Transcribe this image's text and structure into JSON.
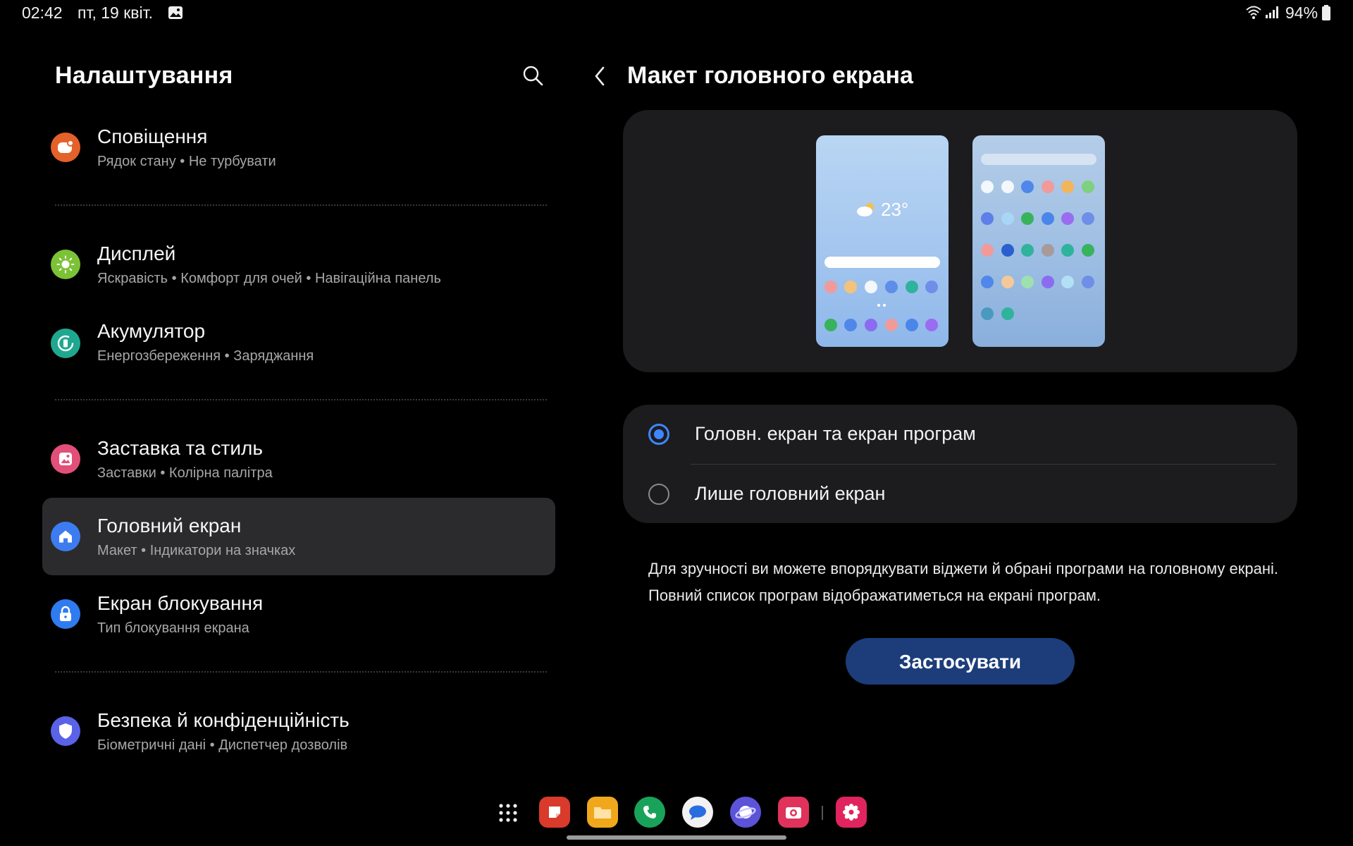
{
  "status_bar": {
    "time": "02:42",
    "date": "пт, 19 квіт.",
    "battery": "94%"
  },
  "left_pane": {
    "title": "Налаштування",
    "items": [
      {
        "title": "Сповіщення",
        "subtitle": "Рядок стану • Не турбувати",
        "icon": "notifications-icon",
        "color": "#e4612a"
      },
      {
        "title": "Дисплей",
        "subtitle": "Яскравість • Комфорт для очей • Навігаційна панель",
        "icon": "sun-icon",
        "color": "#7cc236"
      },
      {
        "title": "Акумулятор",
        "subtitle": "Енергозбереження • Заряджання",
        "icon": "battery-icon",
        "color": "#1fa88f"
      },
      {
        "title": "Заставка та стиль",
        "subtitle": "Заставки • Колірна палітра",
        "icon": "wallpaper-icon",
        "color": "#e2507a"
      },
      {
        "title": "Головний екран",
        "subtitle": "Макет • Індикатори на значках",
        "icon": "home-icon",
        "color": "#3c7cf0",
        "selected": true
      },
      {
        "title": "Екран блокування",
        "subtitle": "Тип блокування екрана",
        "icon": "lock-icon",
        "color": "#2f7bf0"
      },
      {
        "title": "Безпека й конфіденційність",
        "subtitle": "Біометричні дані • Диспетчер дозволів",
        "icon": "shield-icon",
        "color": "#5a62e8"
      }
    ]
  },
  "right_pane": {
    "title": "Макет головного екрана",
    "preview_temperature": "23°",
    "options": [
      {
        "label": "Головн. екран та екран програм",
        "selected": true
      },
      {
        "label": "Лише головний екран",
        "selected": false
      }
    ],
    "description": "Для зручності ви можете впорядкувати віджети й обрані програми на головному екрані. Повний список програм відображатиметься на екрані програм.",
    "apply_label": "Застосувати"
  },
  "dock": {
    "apps": [
      {
        "name": "notes-app-icon",
        "color": "#d93a2b"
      },
      {
        "name": "files-app-icon",
        "color": "#f0a71c"
      },
      {
        "name": "phone-app-icon",
        "color": "#19a35a"
      },
      {
        "name": "messages-app-icon",
        "color": "#f2f2f2"
      },
      {
        "name": "browser-app-icon",
        "color": "#5b53d8"
      },
      {
        "name": "camera-app-icon",
        "color": "#e0325a"
      },
      {
        "name": "gallery-app-icon",
        "color": "#e0245e"
      }
    ]
  }
}
